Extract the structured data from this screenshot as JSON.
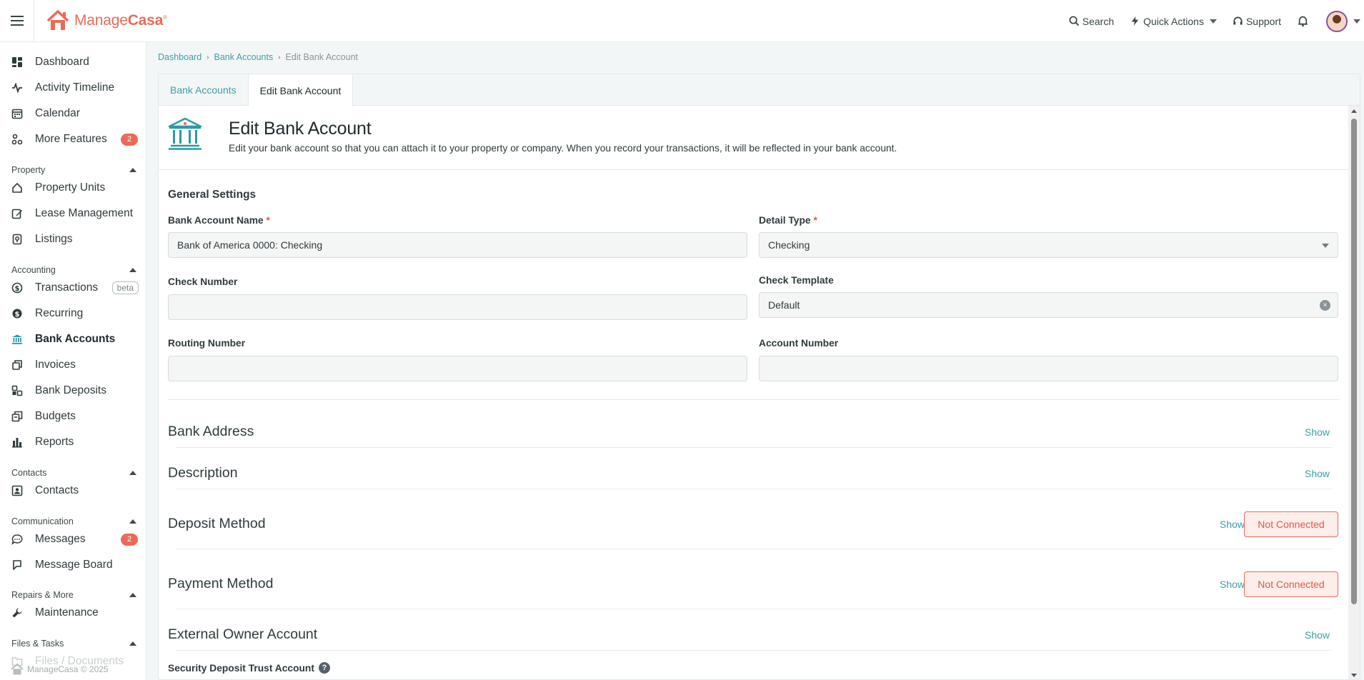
{
  "brand": {
    "name_part1": "Manage",
    "name_part2": "Casa",
    "reg": "®"
  },
  "topbar": {
    "search_label": "Search",
    "quick_actions_label": "Quick Actions",
    "support_label": "Support"
  },
  "sidebar": {
    "items_top": [
      {
        "label": "Dashboard",
        "icon": "dashboard-icon"
      },
      {
        "label": "Activity Timeline",
        "icon": "activity-icon"
      },
      {
        "label": "Calendar",
        "icon": "calendar-icon"
      },
      {
        "label": "More Features",
        "icon": "features-icon",
        "badge": "2"
      }
    ],
    "sections": {
      "property": "Property",
      "accounting": "Accounting",
      "contacts": "Contacts",
      "communication": "Communication",
      "repairs": "Repairs & More",
      "files": "Files & Tasks"
    },
    "property_items": [
      {
        "label": "Property Units"
      },
      {
        "label": "Lease Management"
      },
      {
        "label": "Listings"
      }
    ],
    "accounting_items": [
      {
        "label": "Transactions",
        "tag": "beta"
      },
      {
        "label": "Recurring"
      },
      {
        "label": "Bank Accounts"
      },
      {
        "label": "Invoices"
      },
      {
        "label": "Bank Deposits"
      },
      {
        "label": "Budgets"
      },
      {
        "label": "Reports"
      }
    ],
    "contacts_items": [
      {
        "label": "Contacts"
      }
    ],
    "communication_items": [
      {
        "label": "Messages",
        "badge": "2"
      },
      {
        "label": "Message Board"
      }
    ],
    "repairs_items": [
      {
        "label": "Maintenance"
      }
    ],
    "files_items": [
      {
        "label": "Files / Documents"
      }
    ],
    "footer": "ManageCasa © 2025"
  },
  "breadcrumb": {
    "items": [
      "Dashboard",
      "Bank Accounts"
    ],
    "current": "Edit Bank Account"
  },
  "tabs": [
    "Bank Accounts",
    "Edit Bank Account"
  ],
  "header": {
    "title": "Edit Bank Account",
    "description": "Edit your bank account so that you can attach it to your property or company. When you record your transactions, it will be reflected in your bank account."
  },
  "form": {
    "general_settings": "General Settings",
    "bank_account_name": {
      "label": "Bank Account Name",
      "value": "Bank of America 0000: Checking"
    },
    "detail_type": {
      "label": "Detail Type",
      "value": "Checking"
    },
    "check_number": {
      "label": "Check Number",
      "value": ""
    },
    "check_template": {
      "label": "Check Template",
      "value": "Default"
    },
    "routing_number": {
      "label": "Routing Number",
      "value": ""
    },
    "account_number": {
      "label": "Account Number",
      "value": ""
    },
    "required_mark": "*"
  },
  "sections": {
    "bank_address": "Bank Address",
    "description": "Description",
    "deposit_method": "Deposit Method",
    "payment_method": "Payment Method",
    "external_owner_account": "External Owner Account",
    "security_deposit": "Security Deposit Trust Account",
    "show_label": "Show",
    "not_connected_label": "Not Connected"
  },
  "colors": {
    "accent": "#2b9aa4",
    "brand": "#ec6a55",
    "badge": "#ec6a55"
  }
}
